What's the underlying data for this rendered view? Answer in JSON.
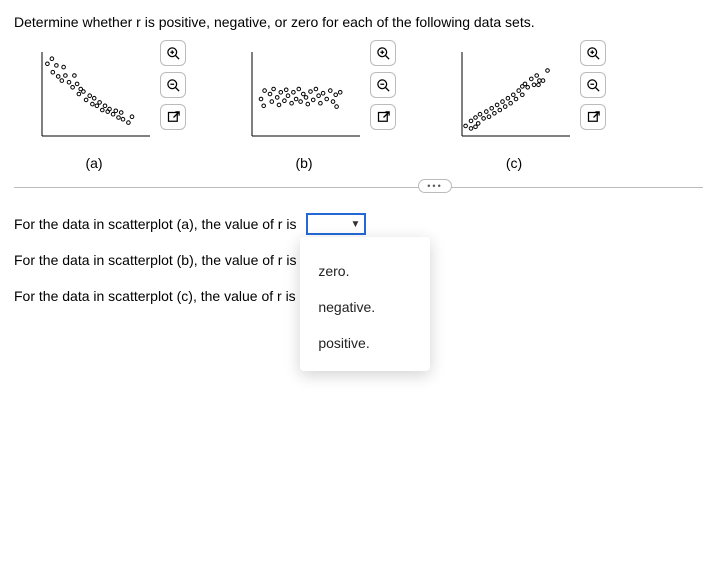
{
  "question": "Determine whether r is positive, negative, or zero for each of the following data sets.",
  "plots": {
    "a": {
      "caption": "(a)"
    },
    "b": {
      "caption": "(b)"
    },
    "c": {
      "caption": "(c)"
    }
  },
  "tools": {
    "zoom_in": "zoom-in",
    "zoom_out": "zoom-out",
    "expand": "expand"
  },
  "divider_label": "•••",
  "answers": {
    "a_text": "For the data in scatterplot (a), the value of r is ",
    "b_text": "For the data in scatterplot (b), the value of r is ",
    "c_text": "For the data in scatterplot (c), the value of r is "
  },
  "dropdown": {
    "selected": "",
    "caret": "▼",
    "options": {
      "zero": "zero.",
      "negative": "negative.",
      "positive": "positive."
    }
  },
  "chart_data": [
    {
      "type": "scatter",
      "label": "(a)",
      "correlation": "negative",
      "xrange": [
        0,
        12
      ],
      "yrange": [
        0,
        10
      ],
      "points": [
        [
          0.6,
          8.6
        ],
        [
          1.1,
          9.2
        ],
        [
          1.2,
          7.6
        ],
        [
          1.6,
          8.4
        ],
        [
          1.8,
          7.1
        ],
        [
          2.4,
          8.2
        ],
        [
          2.2,
          6.6
        ],
        [
          2.6,
          7.2
        ],
        [
          3.0,
          6.4
        ],
        [
          3.6,
          7.2
        ],
        [
          3.4,
          5.8
        ],
        [
          3.9,
          6.2
        ],
        [
          4.3,
          5.6
        ],
        [
          4.1,
          5.0
        ],
        [
          4.6,
          5.3
        ],
        [
          4.9,
          4.3
        ],
        [
          5.3,
          4.8
        ],
        [
          5.6,
          3.8
        ],
        [
          5.8,
          4.5
        ],
        [
          6.1,
          3.6
        ],
        [
          6.4,
          4.0
        ],
        [
          6.7,
          3.1
        ],
        [
          7.0,
          3.6
        ],
        [
          7.3,
          2.9
        ],
        [
          7.5,
          3.2
        ],
        [
          7.9,
          2.6
        ],
        [
          8.2,
          3.0
        ],
        [
          8.5,
          2.2
        ],
        [
          8.8,
          2.8
        ],
        [
          9.6,
          1.6
        ],
        [
          9.0,
          2.0
        ],
        [
          10.0,
          2.3
        ]
      ]
    },
    {
      "type": "scatter",
      "label": "(b)",
      "correlation": "zero",
      "xrange": [
        0,
        12
      ],
      "yrange": [
        0,
        10
      ],
      "points": [
        [
          1.0,
          4.4
        ],
        [
          1.4,
          5.4
        ],
        [
          1.3,
          3.6
        ],
        [
          2.0,
          5.0
        ],
        [
          2.2,
          4.1
        ],
        [
          2.4,
          5.6
        ],
        [
          2.8,
          4.6
        ],
        [
          3.0,
          3.7
        ],
        [
          3.2,
          5.2
        ],
        [
          3.6,
          4.2
        ],
        [
          3.8,
          5.5
        ],
        [
          4.0,
          4.8
        ],
        [
          4.4,
          3.9
        ],
        [
          4.6,
          5.2
        ],
        [
          4.9,
          4.4
        ],
        [
          5.2,
          5.6
        ],
        [
          5.4,
          4.1
        ],
        [
          5.7,
          5.0
        ],
        [
          6.0,
          4.6
        ],
        [
          6.2,
          3.8
        ],
        [
          6.5,
          5.3
        ],
        [
          6.8,
          4.3
        ],
        [
          7.1,
          5.6
        ],
        [
          7.4,
          4.8
        ],
        [
          7.6,
          3.9
        ],
        [
          7.9,
          5.1
        ],
        [
          8.3,
          4.4
        ],
        [
          8.7,
          5.4
        ],
        [
          9.0,
          4.1
        ],
        [
          9.3,
          4.9
        ],
        [
          9.4,
          3.5
        ],
        [
          9.8,
          5.2
        ]
      ]
    },
    {
      "type": "scatter",
      "label": "(c)",
      "correlation": "positive",
      "xrange": [
        0,
        12
      ],
      "yrange": [
        0,
        10
      ],
      "points": [
        [
          0.4,
          1.2
        ],
        [
          1.0,
          1.8
        ],
        [
          1.0,
          0.9
        ],
        [
          1.5,
          2.2
        ],
        [
          1.8,
          1.5
        ],
        [
          2.0,
          2.6
        ],
        [
          1.5,
          1.1
        ],
        [
          2.4,
          2.1
        ],
        [
          2.7,
          2.9
        ],
        [
          3.0,
          2.3
        ],
        [
          3.3,
          3.3
        ],
        [
          3.6,
          2.7
        ],
        [
          3.9,
          3.7
        ],
        [
          4.2,
          3.1
        ],
        [
          4.5,
          4.1
        ],
        [
          4.8,
          3.5
        ],
        [
          5.1,
          4.5
        ],
        [
          5.4,
          3.9
        ],
        [
          5.7,
          4.9
        ],
        [
          6.0,
          4.4
        ],
        [
          6.3,
          5.4
        ],
        [
          6.7,
          5.9
        ],
        [
          6.7,
          4.9
        ],
        [
          7.0,
          6.2
        ],
        [
          7.3,
          5.8
        ],
        [
          7.7,
          6.8
        ],
        [
          8.0,
          6.1
        ],
        [
          8.3,
          7.2
        ],
        [
          8.5,
          6.1
        ],
        [
          8.6,
          6.6
        ],
        [
          9.0,
          6.6
        ],
        [
          9.5,
          7.8
        ]
      ]
    }
  ]
}
